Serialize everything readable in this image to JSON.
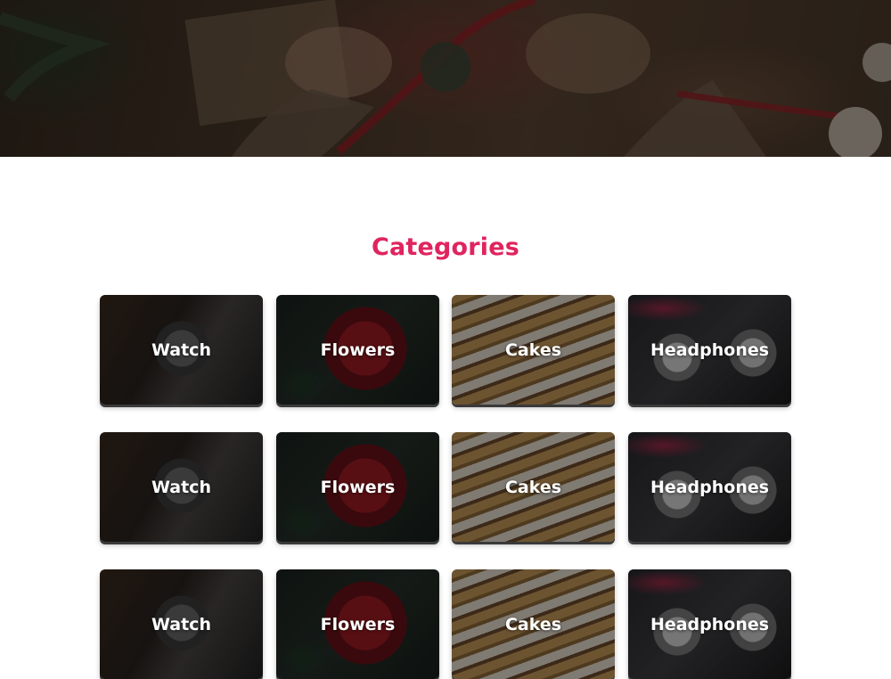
{
  "hero": {
    "image": "gift-wrapping-photo"
  },
  "section": {
    "title": "Categories"
  },
  "categories": [
    {
      "label": "Watch",
      "image": "watch-photo"
    },
    {
      "label": "Flowers",
      "image": "flowers-photo"
    },
    {
      "label": "Cakes",
      "image": "cakes-photo"
    },
    {
      "label": "Headphones",
      "image": "headphones-photo"
    },
    {
      "label": "Watch",
      "image": "watch-photo"
    },
    {
      "label": "Flowers",
      "image": "flowers-photo"
    },
    {
      "label": "Cakes",
      "image": "cakes-photo"
    },
    {
      "label": "Headphones",
      "image": "headphones-photo"
    },
    {
      "label": "Watch",
      "image": "watch-photo"
    },
    {
      "label": "Flowers",
      "image": "flowers-photo"
    },
    {
      "label": "Cakes",
      "image": "cakes-photo"
    },
    {
      "label": "Headphones",
      "image": "headphones-photo"
    }
  ],
  "colors": {
    "accent": "#e0245e",
    "card_label": "#ffffff"
  }
}
